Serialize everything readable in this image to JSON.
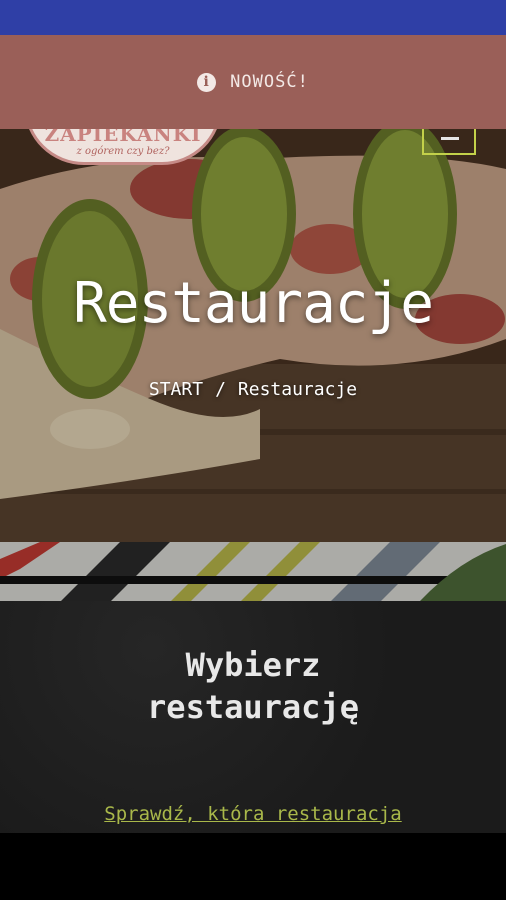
{
  "announcement": {
    "icon": "info-icon",
    "text": "NOWOŚĆ!"
  },
  "logo": {
    "brand": "ZAPIEKANKI",
    "tagline": "z ogórem czy bez?"
  },
  "hero": {
    "title": "Restauracje",
    "breadcrumb": {
      "home": "START",
      "separator": "/",
      "current": "Restauracje"
    }
  },
  "section": {
    "title_line1": "Wybierz",
    "title_line2": "restaurację",
    "link": "Sprawdź, która restauracja"
  },
  "colors": {
    "status_bar": "#2f3fa6",
    "announcement_bg": "#9a5f58",
    "accent_green": "#a9b84a",
    "chalkboard": "#1d1d1d"
  }
}
